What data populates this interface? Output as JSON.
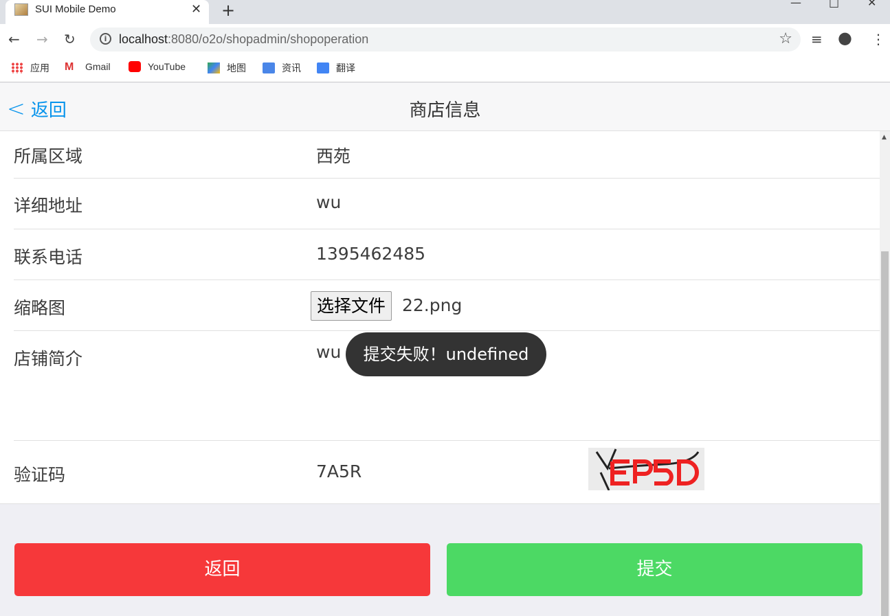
{
  "browser": {
    "tab_title": "SUI Mobile Demo",
    "tab_close": "✕",
    "new_tab": "+",
    "url_host": "localhost",
    "url_path": ":8080/o2o/shopadmin/shopoperation",
    "bookmarks": [
      "应用",
      "Gmail",
      "YouTube",
      "地图",
      "资讯",
      "翻译"
    ]
  },
  "nav": {
    "back_label": "返回",
    "title": "商店信息"
  },
  "form": {
    "rows": [
      {
        "label": "所属区域",
        "value": "西苑"
      },
      {
        "label": "详细地址",
        "value": "wu"
      },
      {
        "label": "联系电话",
        "value": "1395462485"
      },
      {
        "label": "缩略图",
        "file_button": "选择文件",
        "file_name": "22.png"
      },
      {
        "label": "店铺简介",
        "value": "wu"
      },
      {
        "label": "验证码",
        "value": "7A5R"
      }
    ]
  },
  "buttons": {
    "back": "返回",
    "submit": "提交"
  },
  "toast": "提交失败！undefined",
  "colors": {
    "accent": "#0894ec",
    "danger": "#f6383a",
    "success": "#4cd964"
  }
}
